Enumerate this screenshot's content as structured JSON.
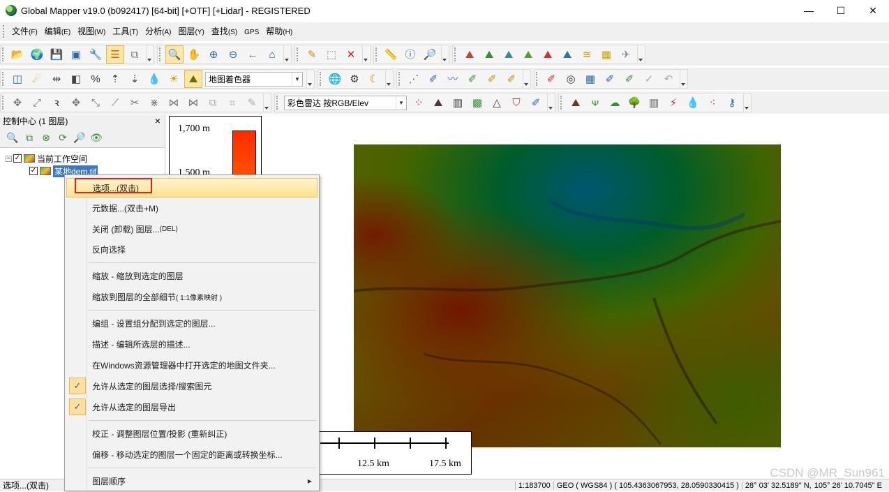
{
  "window": {
    "title": "Global Mapper v19.0 (b092417) [64-bit] [+OTF] [+Lidar] - REGISTERED",
    "min_label": "—",
    "max_label": "☐",
    "close_label": "✕"
  },
  "menu": [
    {
      "label": "文件",
      "key": "(F)"
    },
    {
      "label": "编辑",
      "key": "(E)"
    },
    {
      "label": "视图",
      "key": "(W)"
    },
    {
      "label": "工具",
      "key": "(T)"
    },
    {
      "label": "分析",
      "key": "(A)"
    },
    {
      "label": "图层",
      "key": "(Y)"
    },
    {
      "label": "查找",
      "key": "(S)"
    },
    {
      "label": "GPS",
      "key": ""
    },
    {
      "label": "帮助",
      "key": "(H)"
    }
  ],
  "toolbar": {
    "shader_combo": "地图着色器",
    "lidar_combo": "彩色雷达 按RGB/Elev"
  },
  "control_center": {
    "title": "控制中心 (1 图层)",
    "close": "×",
    "workspace_label": "当前工作空间",
    "layer_label": "某地dem.tif"
  },
  "legend": {
    "top_label": "1,700 m",
    "second_label": "1,500 m"
  },
  "scalebar": {
    "label_mid": "12.5 km",
    "label_end": "17.5 km"
  },
  "context_menu": {
    "items": [
      {
        "label": "选项...(双击)"
      },
      {
        "label": "元数据...(双击+M)"
      },
      {
        "label": "关闭 (卸载) 图层... ",
        "suffix": "(DEL)"
      },
      {
        "label": "反向选择"
      },
      {
        "label": "缩放 - 缩放到选定的图层"
      },
      {
        "label": "缩放到图层的全部细节 ",
        "suffix": "( 1:1像素映射 )"
      },
      {
        "label": "编组 - 设置组分配到选定的图层..."
      },
      {
        "label": "描述 - 编辑所选层的描述..."
      },
      {
        "label": "在Windows资源管理器中打开选定的地图文件夹..."
      },
      {
        "label": "允许从选定的图层选择/搜索图元"
      },
      {
        "label": "允许从选定的图层导出"
      },
      {
        "label": "校正 - 调整图层位置/投影 (重新纠正)"
      },
      {
        "label": "偏移 - 移动选定的图层一个固定的距离或转换坐标..."
      },
      {
        "label": "图层顺序"
      }
    ],
    "check_mark": "✓",
    "submenu_arrow": "▶"
  },
  "status": {
    "left": "选项...(双击)",
    "scale": "1:183700",
    "coords": "GEO ( WGS84 ) ( 105.4363067953, 28.0590330415 )",
    "lat": "28° 03' 32.5189\" N,",
    "lon": "105° 26' 10.7045\" E"
  },
  "watermark": "CSDN @MR_Sun961"
}
